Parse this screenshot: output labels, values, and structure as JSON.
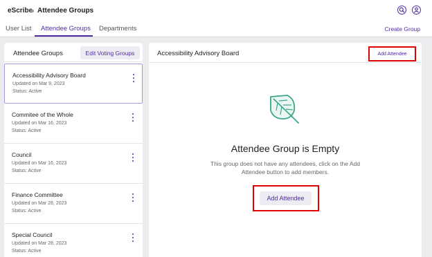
{
  "header": {
    "app_name": "eScribe",
    "page_title": "Attendee Groups",
    "icons": [
      "search-icon",
      "user-icon"
    ]
  },
  "tabs": [
    {
      "label": "User List",
      "active": false
    },
    {
      "label": "Attendee Groups",
      "active": true
    },
    {
      "label": "Departments",
      "active": false
    }
  ],
  "create_group_label": "Create Group",
  "left_panel": {
    "title": "Attendee Groups",
    "edit_voting_label": "Edit Voting Groups",
    "groups": [
      {
        "name": "Accessibility Advisory Board",
        "updated": "Updated on Mar 9, 2023",
        "status": "Status: Active",
        "selected": true
      },
      {
        "name": "Commitee of the Whole",
        "updated": "Updated on Mar 16, 2023",
        "status": "Status: Active",
        "selected": false
      },
      {
        "name": "Council",
        "updated": "Updated on Mar 16, 2023",
        "status": "Status: Active",
        "selected": false
      },
      {
        "name": "Finance Committee",
        "updated": "Updated on Mar 28, 2023",
        "status": "Status: Active",
        "selected": false
      },
      {
        "name": "Special Council",
        "updated": "Updated on Mar 28, 2023",
        "status": "Status: Active",
        "selected": false
      }
    ]
  },
  "right_panel": {
    "title": "Accessibility Advisory Board",
    "add_attendee_small": "Add Attendee",
    "empty_title": "Attendee Group is Empty",
    "empty_desc": "This group does not have any attendees, click on the Add Attendee button to add members.",
    "add_attendee_big": "Add Attendee",
    "empty_icon": "leaf-icon"
  },
  "colors": {
    "accent": "#4d2d9e",
    "highlight": "#e00000",
    "leaf": "#3aa58a"
  }
}
